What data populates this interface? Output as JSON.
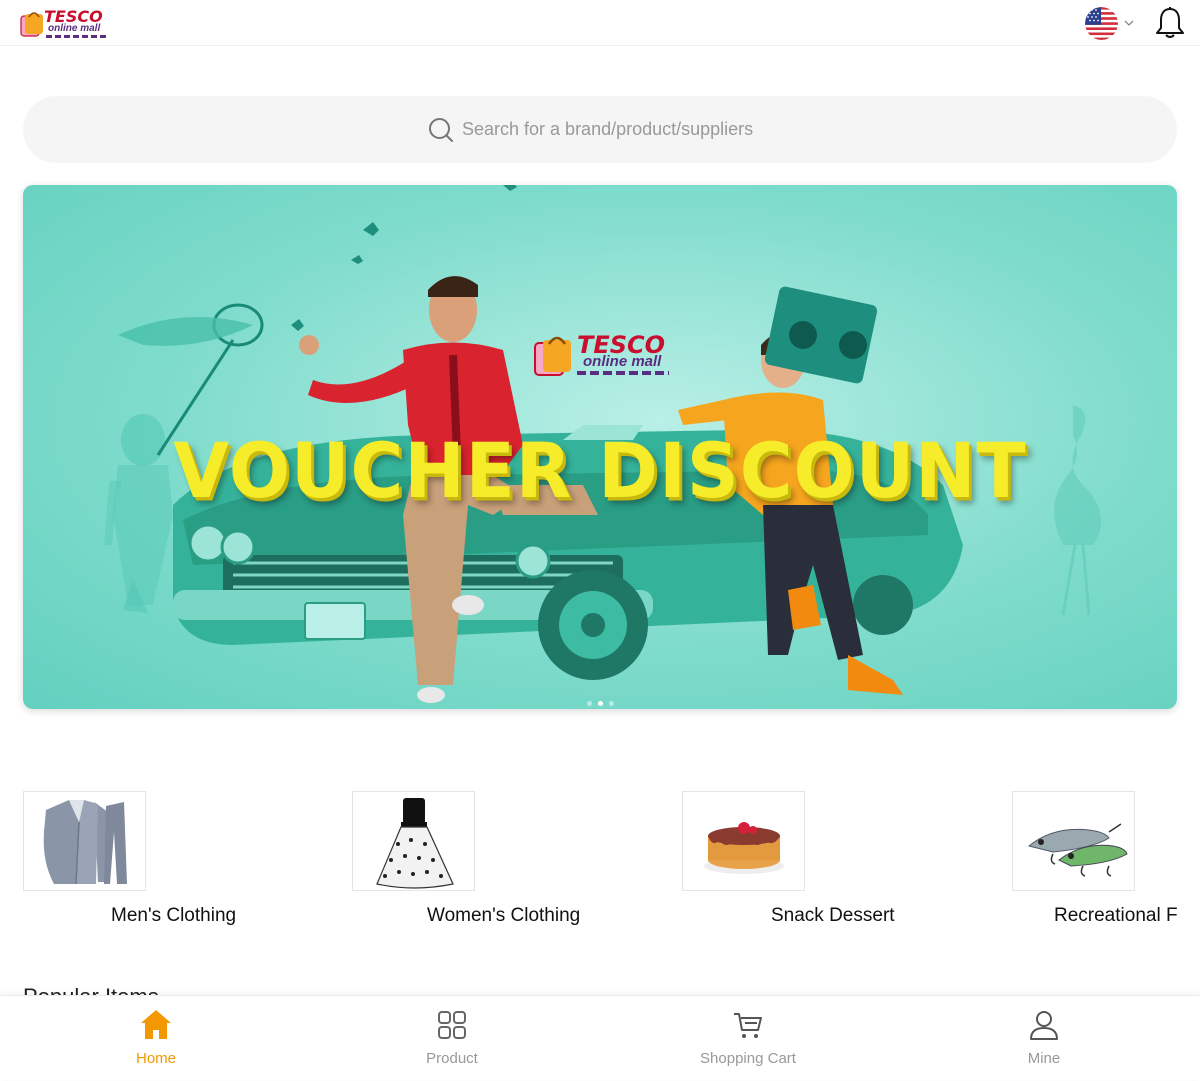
{
  "header": {
    "brand_main": "TESCO",
    "brand_sub": "online mall",
    "language_flag": "us-flag-icon",
    "notification_icon": "bell-icon"
  },
  "search": {
    "placeholder": "Search for a brand/product/suppliers",
    "value": ""
  },
  "banner": {
    "logo_main": "TESCO",
    "logo_sub": "online mall",
    "title": "VOUCHER DISCOUNT",
    "slide_count": 3,
    "active_slide": 2
  },
  "categories": [
    {
      "label": "Men's Clothing",
      "icon": "suit-image"
    },
    {
      "label": "Women's Clothing",
      "icon": "dress-image"
    },
    {
      "label": "Snack Dessert",
      "icon": "pancake-image"
    },
    {
      "label": "Recreational Fi",
      "icon": "fishing-lure-image"
    }
  ],
  "popular": {
    "title": "Popular Items"
  },
  "bottom_nav": [
    {
      "label": "Home",
      "icon": "home-icon",
      "active": true
    },
    {
      "label": "Product",
      "icon": "grid-icon",
      "active": false
    },
    {
      "label": "Shopping Cart",
      "icon": "cart-icon",
      "active": false
    },
    {
      "label": "Mine",
      "icon": "user-icon",
      "active": false
    }
  ],
  "colors": {
    "accent": "#f39800",
    "brand_red": "#c8102e",
    "brand_purple": "#5a2d82",
    "banner_bg": "#7fdccc",
    "banner_title": "#f6ec2a"
  }
}
